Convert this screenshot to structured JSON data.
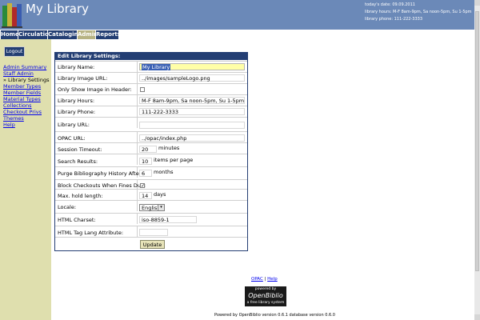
{
  "app": {
    "title": "My Library"
  },
  "info": {
    "date_line": "today's date:   09.09.2011",
    "hours_line": "library hours:   M-F 8am-9pm, Sa noon-5pm, Su 1-5pm",
    "phone_line": "library phone:   111-222-3333"
  },
  "tabs": [
    {
      "label": "Home",
      "active": false
    },
    {
      "label": "Circulation",
      "active": false
    },
    {
      "label": "Cataloging",
      "active": false
    },
    {
      "label": "Admin",
      "active": true
    },
    {
      "label": "Reports",
      "active": false
    }
  ],
  "sidebar": {
    "logout_label": "Logout",
    "items": [
      {
        "label": "Admin Summary",
        "current": false
      },
      {
        "label": "Staff Admin",
        "current": false
      },
      {
        "label": "» Library Settings",
        "current": true
      },
      {
        "label": "Member Types",
        "current": false
      },
      {
        "label": "Member Fields",
        "current": false
      },
      {
        "label": "Material Types",
        "current": false
      },
      {
        "label": "Collections",
        "current": false
      },
      {
        "label": "Checkout Privs",
        "current": false
      },
      {
        "label": "Themes",
        "current": false
      },
      {
        "label": "Help",
        "current": false
      }
    ]
  },
  "settings": {
    "header": "Edit Library Settings:",
    "library_name": {
      "label": "Library Name:",
      "value": "My Library"
    },
    "library_image_url": {
      "label": "Library Image URL:",
      "value": "../images/sampleLogo.png"
    },
    "only_show_image": {
      "label": "Only Show Image in Header:",
      "checked": false
    },
    "library_hours": {
      "label": "Library Hours:",
      "value": "M-F 8am-9pm, Sa noon-5pm, Su 1-5pm"
    },
    "library_phone": {
      "label": "Library Phone:",
      "value": "111-222-3333"
    },
    "library_url": {
      "label": "Library URL:",
      "value": ""
    },
    "opac_url": {
      "label": "OPAC URL:",
      "value": "../opac/index.php"
    },
    "session_timeout": {
      "label": "Session Timeout:",
      "value": "20",
      "suffix": "minutes"
    },
    "search_results": {
      "label": "Search Results:",
      "value": "10",
      "suffix": "items per page"
    },
    "purge_history": {
      "label": "Purge Bibliography History After:",
      "value": "6",
      "suffix": "months"
    },
    "block_checkouts": {
      "label": "Block Checkouts When Fines Due:",
      "checked": true,
      "checkmark": "✓"
    },
    "max_hold": {
      "label": "Max. hold length:",
      "value": "14",
      "suffix": "days"
    },
    "locale": {
      "label": "Locale:",
      "selected": "English",
      "arrow": "▾"
    },
    "html_charset": {
      "label": "HTML Charset:",
      "value": "iso-8859-1"
    },
    "html_lang": {
      "label": "HTML Tag Lang Attribute:",
      "value": ""
    },
    "update_label": "Update"
  },
  "footer": {
    "opac_link": "OPAC",
    "separator": " | ",
    "help_link": "Help",
    "badge_top": "powered by",
    "badge_name": "OpenBiblio",
    "badge_bottom": "a free library system",
    "version_text": "Powered by OpenBiblio version 0.6.1 database version 0.6.0"
  },
  "colors": {
    "header_bg": "#6b89b8",
    "tab_bg": "#233e73",
    "tab_active_bg": "#b7b383",
    "sidebar_bg": "#dfdfae",
    "focused_input_bg": "#ffffa8"
  }
}
